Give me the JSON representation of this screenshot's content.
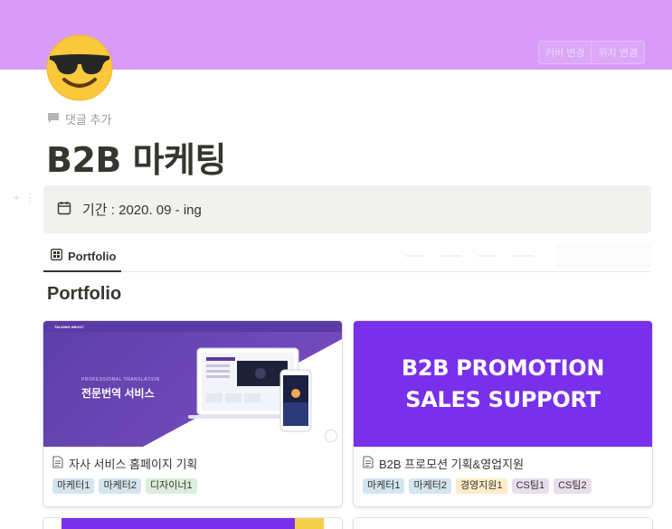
{
  "cover": {
    "color": "#d89bf7",
    "buttons": [
      "커버 변경",
      "위치 변경"
    ]
  },
  "page": {
    "icon": "smiling-face-with-sunglasses-icon",
    "comment_label": "댓글 추가",
    "title": "B2B 마케팅"
  },
  "callout": {
    "icon": "calendar-icon",
    "text": "기간 : 2020. 09 - ing"
  },
  "tabs": [
    {
      "label": "Portfolio",
      "icon": "gallery-view-icon",
      "active": true
    }
  ],
  "view": {
    "title": "Portfolio"
  },
  "cards": [
    {
      "title": "자사 서비스 홈페이지 기획",
      "icon": "page-icon",
      "image": {
        "type": "website-hero",
        "brand": "TALKING ABOUT",
        "subtitle": "PROFESSIONAL TRANSLATION",
        "headline": "전문번역 서비스"
      },
      "tags": [
        {
          "label": "마케터1",
          "color": "#d3e5ef"
        },
        {
          "label": "마케터2",
          "color": "#d3e5ef"
        },
        {
          "label": "디자이너1",
          "color": "#dbeddb"
        }
      ]
    },
    {
      "title": "B2B 프로모션 기획&영업지원",
      "icon": "page-icon",
      "image": {
        "type": "banner",
        "color": "#7830ea",
        "line1": "B2B PROMOTION",
        "line2": "SALES SUPPORT"
      },
      "tags": [
        {
          "label": "마케터1",
          "color": "#d3e5ef"
        },
        {
          "label": "마케터2",
          "color": "#d3e5ef"
        },
        {
          "label": "경영지원1",
          "color": "#fdecc8"
        },
        {
          "label": "CS팀1",
          "color": "#e8deee"
        },
        {
          "label": "CS팀2",
          "color": "#e8deee"
        }
      ]
    }
  ]
}
